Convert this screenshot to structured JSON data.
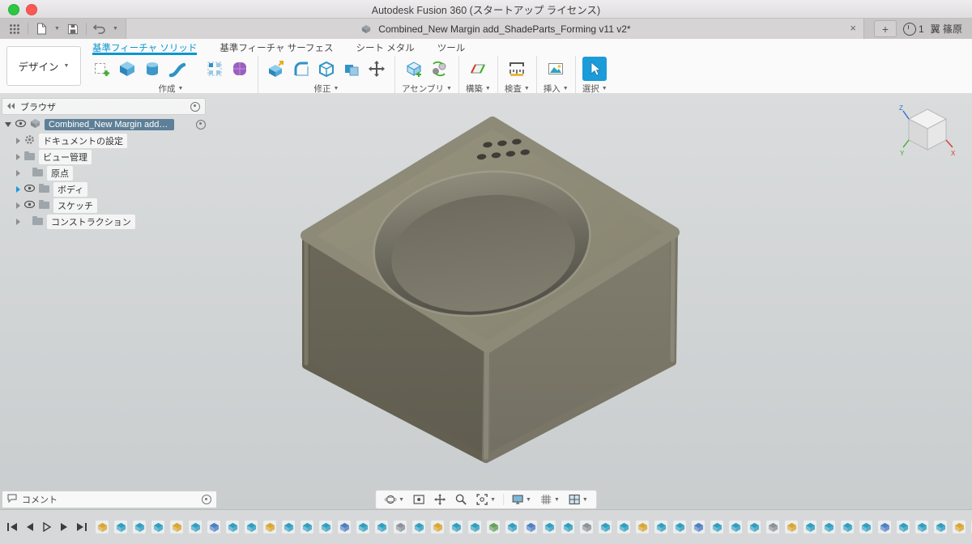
{
  "window": {
    "title": "Autodesk Fusion 360 (スタートアップ ライセンス)"
  },
  "ui": {
    "caret": "▼",
    "close": "×",
    "plus": "+"
  },
  "tabbar": {
    "document_tab": "Combined_New Margin add_ShadeParts_Forming v11 v2*",
    "notification_count": "1",
    "user_name": "翼 篠原"
  },
  "toolbar": {
    "design_menu": "デザイン",
    "tabs": {
      "solid": "基準フィーチャ ソリッド",
      "surface": "基準フィーチャ サーフェス",
      "sheetmetal": "シート メタル",
      "tools": "ツール"
    },
    "groups": {
      "create": "作成",
      "modify": "修正",
      "assemble": "アセンブリ",
      "construct": "構築",
      "inspect": "検査",
      "insert": "挿入",
      "select": "選択"
    }
  },
  "browser": {
    "title": "ブラウザ",
    "root_label": "Combined_New Margin add_...",
    "items": {
      "settings": "ドキュメントの設定",
      "views": "ビュー管理",
      "origin": "原点",
      "bodies": "ボディ",
      "sketches": "スケッチ",
      "construction": "コンストラクション"
    }
  },
  "comments": {
    "title": "コメント"
  },
  "colors": {
    "accent_blue": "#0a96cf",
    "selected_tool_bg": "#1b9bd8",
    "selected_item_bg": "#5d7f97",
    "model_top": "#908d7c",
    "model_left": "#67655a",
    "model_right": "#7d7a6e",
    "timeline_teal": "#2f9fc0",
    "timeline_yellow": "#d9a62e"
  },
  "timeline": {
    "features": [
      {
        "type": "sketch",
        "color": "#d9a62e"
      },
      {
        "type": "extrude",
        "color": "#2f9fc0"
      },
      {
        "type": "extrude",
        "color": "#2f9fc0"
      },
      {
        "type": "fillet",
        "color": "#2f9fc0"
      },
      {
        "type": "sketch",
        "color": "#d9a62e"
      },
      {
        "type": "extrude",
        "color": "#2f9fc0"
      },
      {
        "type": "combine",
        "color": "#4e7fc4"
      },
      {
        "type": "extrude",
        "color": "#2f9fc0"
      },
      {
        "type": "fillet",
        "color": "#2f9fc0"
      },
      {
        "type": "sketch",
        "color": "#d9a62e"
      },
      {
        "type": "extrude",
        "color": "#2f9fc0"
      },
      {
        "type": "extrude",
        "color": "#2f9fc0"
      },
      {
        "type": "shell",
        "color": "#2f9fc0"
      },
      {
        "type": "combine",
        "color": "#4e7fc4"
      },
      {
        "type": "extrude",
        "color": "#2f9fc0"
      },
      {
        "type": "fillet",
        "color": "#2f9fc0"
      },
      {
        "type": "mirror",
        "color": "#8b9298"
      },
      {
        "type": "extrude",
        "color": "#2f9fc0"
      },
      {
        "type": "sketch",
        "color": "#d9a62e"
      },
      {
        "type": "extrude",
        "color": "#2f9fc0"
      },
      {
        "type": "hole",
        "color": "#2f9fc0"
      },
      {
        "type": "pattern",
        "color": "#67a05b"
      },
      {
        "type": "extrude",
        "color": "#2f9fc0"
      },
      {
        "type": "combine",
        "color": "#4e7fc4"
      },
      {
        "type": "extrude",
        "color": "#2f9fc0"
      },
      {
        "type": "fillet",
        "color": "#2f9fc0"
      },
      {
        "type": "parameter",
        "color": "#8b9298"
      },
      {
        "type": "extrude",
        "color": "#2f9fc0"
      },
      {
        "type": "extrude",
        "color": "#2f9fc0"
      },
      {
        "type": "sketch",
        "color": "#d9a62e"
      },
      {
        "type": "extrude",
        "color": "#2f9fc0"
      },
      {
        "type": "fillet",
        "color": "#2f9fc0"
      },
      {
        "type": "combine",
        "color": "#4e7fc4"
      },
      {
        "type": "extrude",
        "color": "#2f9fc0"
      },
      {
        "type": "shell",
        "color": "#2f9fc0"
      },
      {
        "type": "extrude",
        "color": "#2f9fc0"
      },
      {
        "type": "mirror",
        "color": "#8b9298"
      },
      {
        "type": "sketch",
        "color": "#d9a62e"
      },
      {
        "type": "extrude",
        "color": "#2f9fc0"
      },
      {
        "type": "hole",
        "color": "#2f9fc0"
      },
      {
        "type": "extrude",
        "color": "#2f9fc0"
      },
      {
        "type": "fillet",
        "color": "#2f9fc0"
      },
      {
        "type": "combine",
        "color": "#4e7fc4"
      },
      {
        "type": "extrude",
        "color": "#2f9fc0"
      },
      {
        "type": "extrude",
        "color": "#2f9fc0"
      },
      {
        "type": "fillet",
        "color": "#2f9fc0"
      },
      {
        "type": "sketch",
        "color": "#d9a62e"
      },
      {
        "type": "extrude",
        "color": "#2f9fc0"
      }
    ]
  }
}
